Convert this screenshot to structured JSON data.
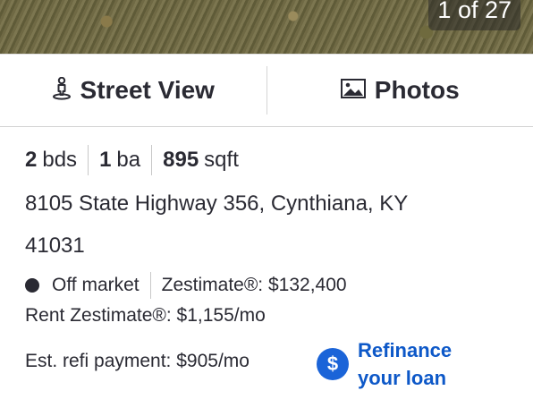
{
  "photo": {
    "counter": "1 of 27"
  },
  "view_tabs": {
    "street_view": {
      "label": "Street View",
      "icon": "street-view-person-icon"
    },
    "photos": {
      "label": "Photos",
      "icon": "photos-icon"
    }
  },
  "facts": {
    "beds_value": "2",
    "beds_unit": "bds",
    "baths_value": "1",
    "baths_unit": "ba",
    "sqft_value": "895",
    "sqft_unit": "sqft"
  },
  "address": {
    "line1": "8105 State Highway 356, Cynthiana, KY",
    "line2": "41031"
  },
  "status": {
    "market": "Off market",
    "zestimate": "Zestimate®: $132,400",
    "rent_zestimate": "Rent Zestimate®: $1,155/mo"
  },
  "refinance": {
    "payment": "Est. refi payment: $905/mo",
    "link_line1": "Refinance",
    "link_line2": "your loan",
    "icon_glyph": "$",
    "accent_color": "#1b64d8"
  }
}
